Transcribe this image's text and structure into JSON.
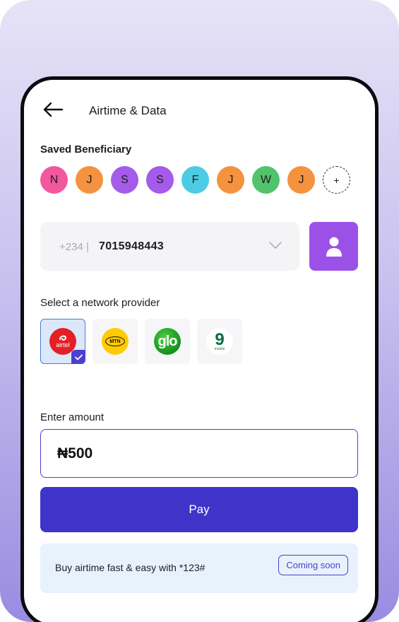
{
  "header": {
    "title": "Airtime & Data"
  },
  "beneficiaries": {
    "label": "Saved Beneficiary",
    "items": [
      {
        "initial": "N",
        "color": "#f2589e"
      },
      {
        "initial": "J",
        "color": "#f4923f"
      },
      {
        "initial": "S",
        "color": "#a45bea"
      },
      {
        "initial": "S",
        "color": "#a45bea"
      },
      {
        "initial": "F",
        "color": "#4ecbe4"
      },
      {
        "initial": "J",
        "color": "#f4923f"
      },
      {
        "initial": "W",
        "color": "#53c26d"
      },
      {
        "initial": "J",
        "color": "#f4923f"
      }
    ],
    "add_label": "+"
  },
  "phone": {
    "country_code": "+234 |",
    "number": "7015948443"
  },
  "network": {
    "label": "Select a network provider",
    "providers": [
      {
        "name": "airtel",
        "logo_text": "airtel",
        "selected": true
      },
      {
        "name": "mtn",
        "logo_text": "MTN",
        "selected": false
      },
      {
        "name": "glo",
        "logo_text": "glo",
        "selected": false
      },
      {
        "name": "9mobile",
        "logo_text": "9",
        "logo_sub": "mobile",
        "selected": false
      }
    ]
  },
  "amount": {
    "label": "Enter amount",
    "value": "₦500"
  },
  "pay": {
    "label": "Pay"
  },
  "ussd": {
    "text": "Buy airtime fast & easy with *123#",
    "badge": "Coming soon"
  },
  "colors": {
    "primary": "#3f34c9",
    "contact_button": "#9b51e8",
    "selected_provider_bg": "#dbe8fb"
  }
}
